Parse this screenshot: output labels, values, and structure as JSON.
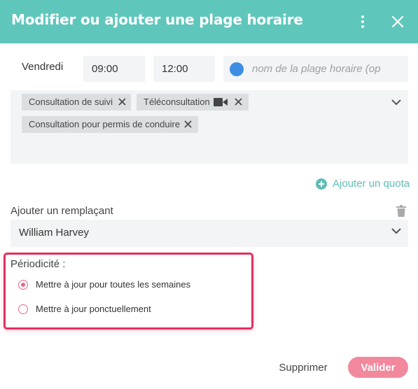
{
  "dialog": {
    "title": "Modifier ou ajouter une plage horaire"
  },
  "slot": {
    "day": "Vendredi",
    "start_time": "09:00",
    "end_time": "12:00",
    "name_placeholder": "nom de la plage horaire (optionnel)",
    "color": "#3d8de3"
  },
  "consultation_types": [
    {
      "label": "Consultation de suivi"
    },
    {
      "label": "Téléconsultation",
      "icon": "video-camera-icon"
    },
    {
      "label": "Consultation pour permis de conduire"
    }
  ],
  "quota": {
    "add_label": "Ajouter un quota"
  },
  "replacement": {
    "label": "Ajouter un remplaçant",
    "value": "William Harvey"
  },
  "periodicity": {
    "title": "Périodicité :",
    "options": [
      {
        "label": "Mettre à jour pour toutes les semaines",
        "selected": true
      },
      {
        "label": "Mettre à jour ponctuellement",
        "selected": false
      }
    ]
  },
  "actions": {
    "delete_label": "Supprimer",
    "validate_label": "Valider"
  },
  "colors": {
    "header": "#5fc6bb",
    "accent_pink": "#f2889d",
    "highlight_border": "#e3305f",
    "quota_link": "#5fbdb4"
  }
}
